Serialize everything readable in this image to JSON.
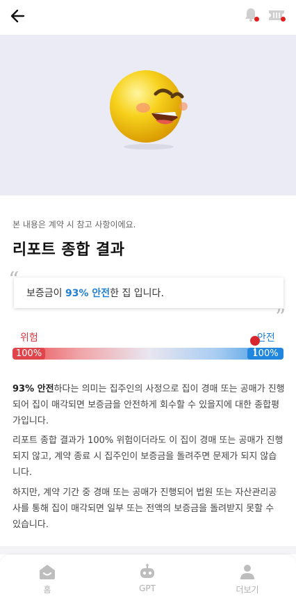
{
  "header": {
    "back_icon": "arrow-left-icon",
    "bell_icon": "bell-icon",
    "ticket_icon": "ticket-icon",
    "badge_color": "#e02020"
  },
  "hero": {
    "background": "#ebebf6",
    "emoji_icon": "smiling-face-icon"
  },
  "report": {
    "notice": "본 내용은 계약 시 참고 사항이에요.",
    "title": "리포트 종합 결과",
    "quote_prefix": "보증금이 ",
    "quote_highlight": "93% 안전",
    "quote_suffix": "한 집 입니다.",
    "quote_open": "“",
    "quote_close": "”"
  },
  "gauge": {
    "danger_label": "위험",
    "safe_label": "안전",
    "danger_value": "100%",
    "safe_value": "100%",
    "safety_percent": 93,
    "danger_color": "#e0454b",
    "safe_color": "#2186dd"
  },
  "description": {
    "p1_bold": "93% 안전",
    "p1_rest": "하다는 의미는 집주인의 사정으로 집이 경매 또는 공매가 진행되어 집이 매각되면 보증금을 안전하게 회수할 수 있을지에 대한 종합평가입니다.",
    "p2": "리포트 종합 결과가 100% 위험이더라도 이 집이 경매 또는 공매가 진행되지 않고, 계약 종료 시 집주인이 보증금을 돌려주면 문제가 되지 않습니다.",
    "p3": "하지만, 계약 기간 중 경매 또는 공매가 진행되어 법원 또는 자산관리공사를 통해 집이 매각되면 일부 또는 전액의 보증금을 돌려받지 못할 수 있습니다."
  },
  "bottom_nav": {
    "home": "홈",
    "gpt": "GPT",
    "more": "더보기"
  }
}
